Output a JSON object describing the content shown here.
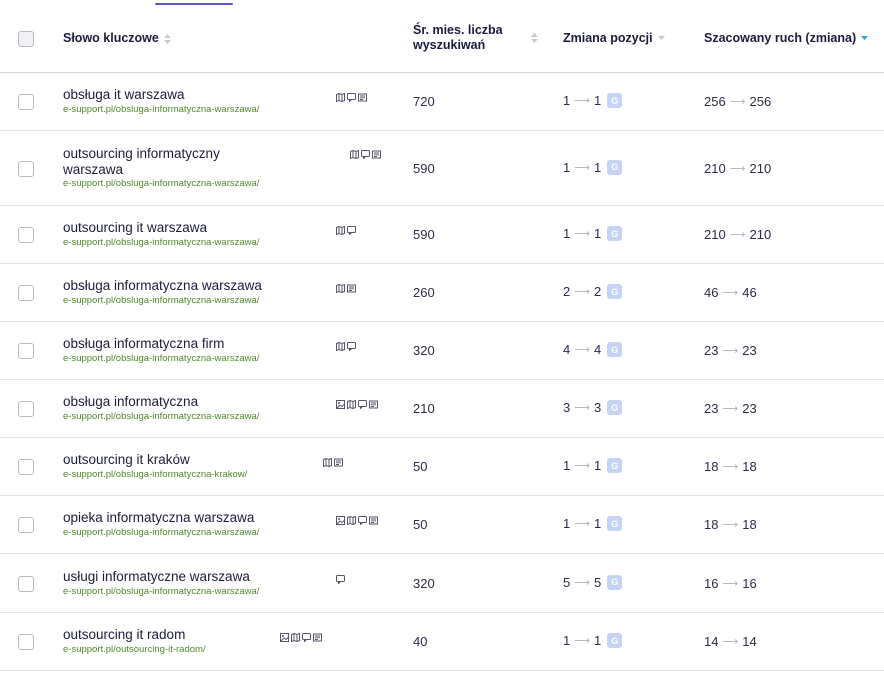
{
  "header": {
    "keyword": "Słowo kluczowe",
    "volume_line1": "Śr. mies. liczba",
    "volume_line2": "wyszukiwań",
    "position_change": "Zmiana pozycji",
    "traffic": "Szacowany ruch (zmiana)"
  },
  "colors": {
    "accent": "#5a55c8",
    "url": "#4f8a28",
    "sort_active": "#2fa0d8",
    "google_badge": "#c5d3f5"
  },
  "arrow_glyph": "⟶",
  "google_badge_letter": "G",
  "rows": [
    {
      "keyword": "obsługa it warszawa",
      "url": "e-support.pl/obsluga-informatyczna-warszawa/",
      "volume": "720",
      "pos_from": "1",
      "pos_to": "1",
      "traffic_from": "256",
      "traffic_to": "256",
      "features": [
        "map-icon",
        "chat-icon",
        "news-icon"
      ]
    },
    {
      "keyword": "outsourcing informatyczny warszawa",
      "url": "e-support.pl/obsluga-informatyczna-warszawa/",
      "volume": "590",
      "pos_from": "1",
      "pos_to": "1",
      "traffic_from": "210",
      "traffic_to": "210",
      "features": [
        "map-icon",
        "chat-icon",
        "news-icon"
      ]
    },
    {
      "keyword": "outsourcing it warszawa",
      "url": "e-support.pl/obsluga-informatyczna-warszawa/",
      "volume": "590",
      "pos_from": "1",
      "pos_to": "1",
      "traffic_from": "210",
      "traffic_to": "210",
      "features": [
        "map-icon",
        "chat-icon"
      ]
    },
    {
      "keyword": "obsługa informatyczna warszawa",
      "url": "e-support.pl/obsluga-informatyczna-warszawa/",
      "volume": "260",
      "pos_from": "2",
      "pos_to": "2",
      "traffic_from": "46",
      "traffic_to": "46",
      "features": [
        "map-icon",
        "news-icon"
      ]
    },
    {
      "keyword": "obsługa informatyczna firm",
      "url": "e-support.pl/obsluga-informatyczna-warszawa/",
      "volume": "320",
      "pos_from": "4",
      "pos_to": "4",
      "traffic_from": "23",
      "traffic_to": "23",
      "features": [
        "map-icon",
        "chat-icon"
      ]
    },
    {
      "keyword": "obsługa informatyczna",
      "url": "e-support.pl/obsluga-informatyczna-warszawa/",
      "volume": "210",
      "pos_from": "3",
      "pos_to": "3",
      "traffic_from": "23",
      "traffic_to": "23",
      "features": [
        "image-icon",
        "map-icon",
        "chat-icon",
        "news-icon"
      ]
    },
    {
      "keyword": "outsourcing it kraków",
      "url": "e-support.pl/obsluga-informatyczna-krakow/",
      "volume": "50",
      "pos_from": "1",
      "pos_to": "1",
      "traffic_from": "18",
      "traffic_to": "18",
      "features": [
        "map-icon",
        "news-icon"
      ]
    },
    {
      "keyword": "opieka informatyczna warszawa",
      "url": "e-support.pl/obsluga-informatyczna-warszawa/",
      "volume": "50",
      "pos_from": "1",
      "pos_to": "1",
      "traffic_from": "18",
      "traffic_to": "18",
      "features": [
        "image-icon",
        "map-icon",
        "chat-icon",
        "news-icon"
      ]
    },
    {
      "keyword": "usługi informatyczne warszawa",
      "url": "e-support.pl/obsluga-informatyczna-warszawa/",
      "volume": "320",
      "pos_from": "5",
      "pos_to": "5",
      "traffic_from": "16",
      "traffic_to": "16",
      "features": [
        "chat-icon"
      ]
    },
    {
      "keyword": "outsourcing it radom",
      "url": "e-support.pl/outsourcing-it-radom/",
      "volume": "40",
      "pos_from": "1",
      "pos_to": "1",
      "traffic_from": "14",
      "traffic_to": "14",
      "features": [
        "image-icon",
        "map-icon",
        "chat-icon",
        "news-icon"
      ]
    }
  ]
}
